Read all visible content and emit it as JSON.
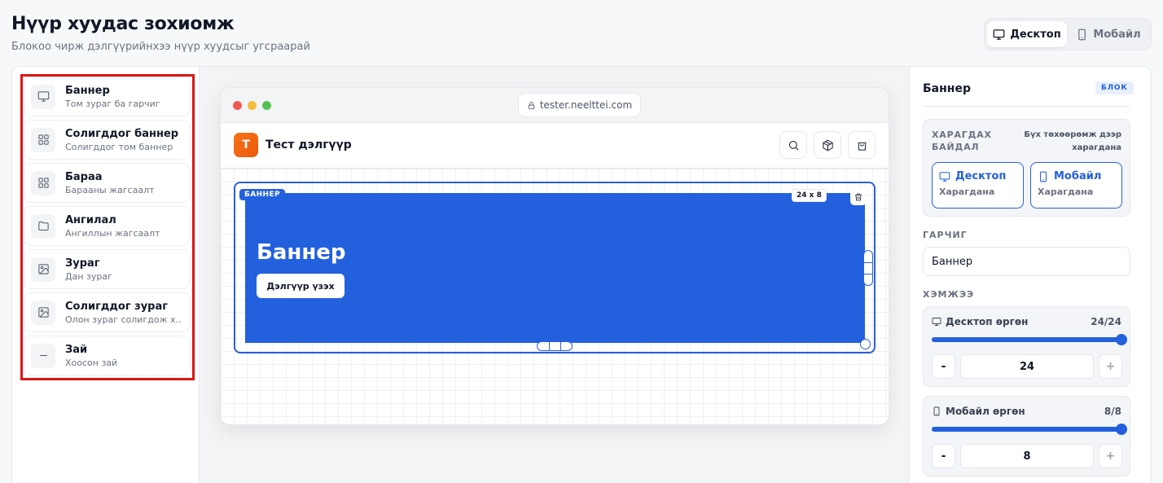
{
  "header": {
    "title": "Нүүр хуудас зохиомж",
    "subtitle": "Блокоо чирж дэлгүүрийнхээ нүүр хуудсыг угсраарай"
  },
  "view_toggle": {
    "desktop_label": "Десктоп",
    "mobile_label": "Мобайл",
    "active": "desktop"
  },
  "blocks": [
    {
      "title": "Баннер",
      "desc": "Том зураг ба гарчиг",
      "icon": "monitor-icon"
    },
    {
      "title": "Солигддог баннер",
      "desc": "Солигддог том баннер",
      "icon": "grid-icon"
    },
    {
      "title": "Бараа",
      "desc": "Барааны жагсаалт",
      "icon": "grid-icon"
    },
    {
      "title": "Ангилал",
      "desc": "Ангиллын жагсаалт",
      "icon": "folder-icon"
    },
    {
      "title": "Зураг",
      "desc": "Дан зураг",
      "icon": "image-icon"
    },
    {
      "title": "Солигддог зураг",
      "desc": "Олон зураг солигдож хара...",
      "icon": "image-icon"
    },
    {
      "title": "Зай",
      "desc": "Хоосон зай",
      "icon": "minus-icon"
    }
  ],
  "preview": {
    "url": "tester.neelttei.com",
    "shop_initial": "T",
    "shop_name": "Тест дэлгүүр",
    "banner_tag": "БАННЕР",
    "size_tag": "24 x 8",
    "banner_title": "Баннер",
    "banner_button": "Дэлгүүр үзэх",
    "banner_color": "#2360dd"
  },
  "properties": {
    "title": "Баннер",
    "badge": "БЛОК",
    "visibility_label": "ХАРАГДАХ БАЙДАЛ",
    "visibility_note": "Бүх төхөөрөмж дээр харагдана",
    "desktop_option": {
      "label": "Десктоп",
      "status": "Харагдана"
    },
    "mobile_option": {
      "label": "Мобайл",
      "status": "Харагдана"
    },
    "heading_label": "ГАРЧИГ",
    "heading_value": "Баннер",
    "size_label": "ХЭМЖЭЭ",
    "desktop_width": {
      "label": "Десктоп өргөн",
      "display": "24/24",
      "value": "24",
      "fraction": 1.0
    },
    "mobile_width": {
      "label": "Мобайл өргөн",
      "display": "8/8",
      "value": "8",
      "fraction": 1.0
    },
    "minus_label": "-",
    "plus_label": "+"
  },
  "colors": {
    "accent": "#2360dd",
    "highlight_border": "#dc1515"
  }
}
